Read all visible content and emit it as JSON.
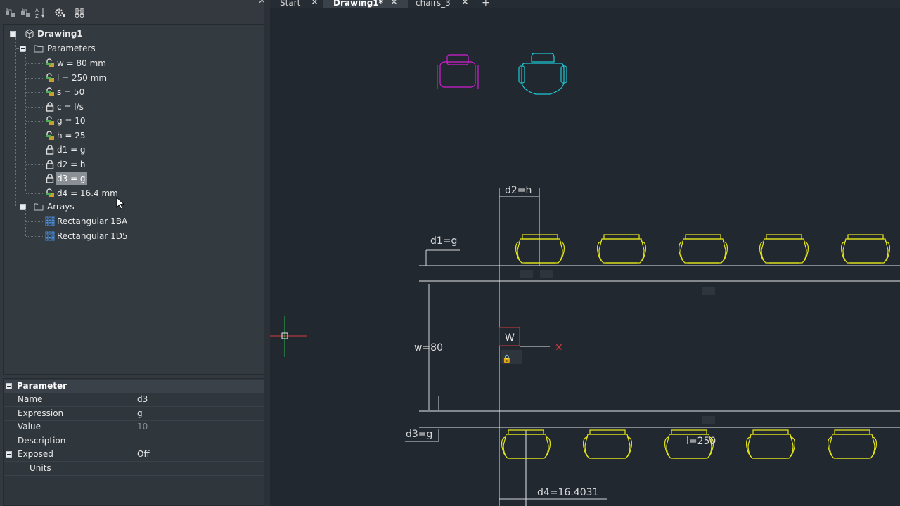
{
  "tabs": [
    {
      "label": "Start",
      "closable": true
    },
    {
      "label": "Drawing1*",
      "closable": true,
      "active": true
    },
    {
      "label": "chairs_3",
      "closable": true
    }
  ],
  "tabs_add_label": "+",
  "tree": {
    "root_label": "Drawing1",
    "parameters_label": "Parameters",
    "parameters": [
      {
        "label": "w = 80 mm",
        "locked": false
      },
      {
        "label": "l = 250 mm",
        "locked": false
      },
      {
        "label": "s = 50",
        "locked": false
      },
      {
        "label": "c = l/s",
        "locked": true
      },
      {
        "label": "g = 10",
        "locked": false
      },
      {
        "label": "h = 25",
        "locked": false
      },
      {
        "label": "d1 = g",
        "locked": true
      },
      {
        "label": "d2 = h",
        "locked": true
      },
      {
        "label": "d3 = g",
        "locked": true,
        "selected": true
      },
      {
        "label": "d4 = 16.4 mm",
        "locked": false
      }
    ],
    "arrays_label": "Arrays",
    "arrays": [
      {
        "label": "Rectangular 1BA"
      },
      {
        "label": "Rectangular 1D5"
      }
    ]
  },
  "properties": {
    "header": "Parameter",
    "rows": [
      {
        "name": "Name",
        "value": "d3"
      },
      {
        "name": "Expression",
        "value": "g"
      },
      {
        "name": "Value",
        "value": "10",
        "dim": true
      },
      {
        "name": "Description",
        "value": ""
      },
      {
        "name": "Exposed",
        "value": "Off"
      },
      {
        "name": "Units",
        "value": ""
      }
    ]
  },
  "drawing": {
    "dim_d1": "d1=g",
    "dim_d2": "d2=h",
    "dim_d3": "d3=g",
    "dim_d4": "d4=16.4031",
    "dim_w": "w=80",
    "dim_l": "l=250",
    "w_grip_label": "W",
    "colors": {
      "chairs": "#e6e619",
      "magenta": "#d21ed2",
      "cyan": "#1ec8d2",
      "lines": "#e8e8e8",
      "dims": "#d8d8d8"
    }
  }
}
